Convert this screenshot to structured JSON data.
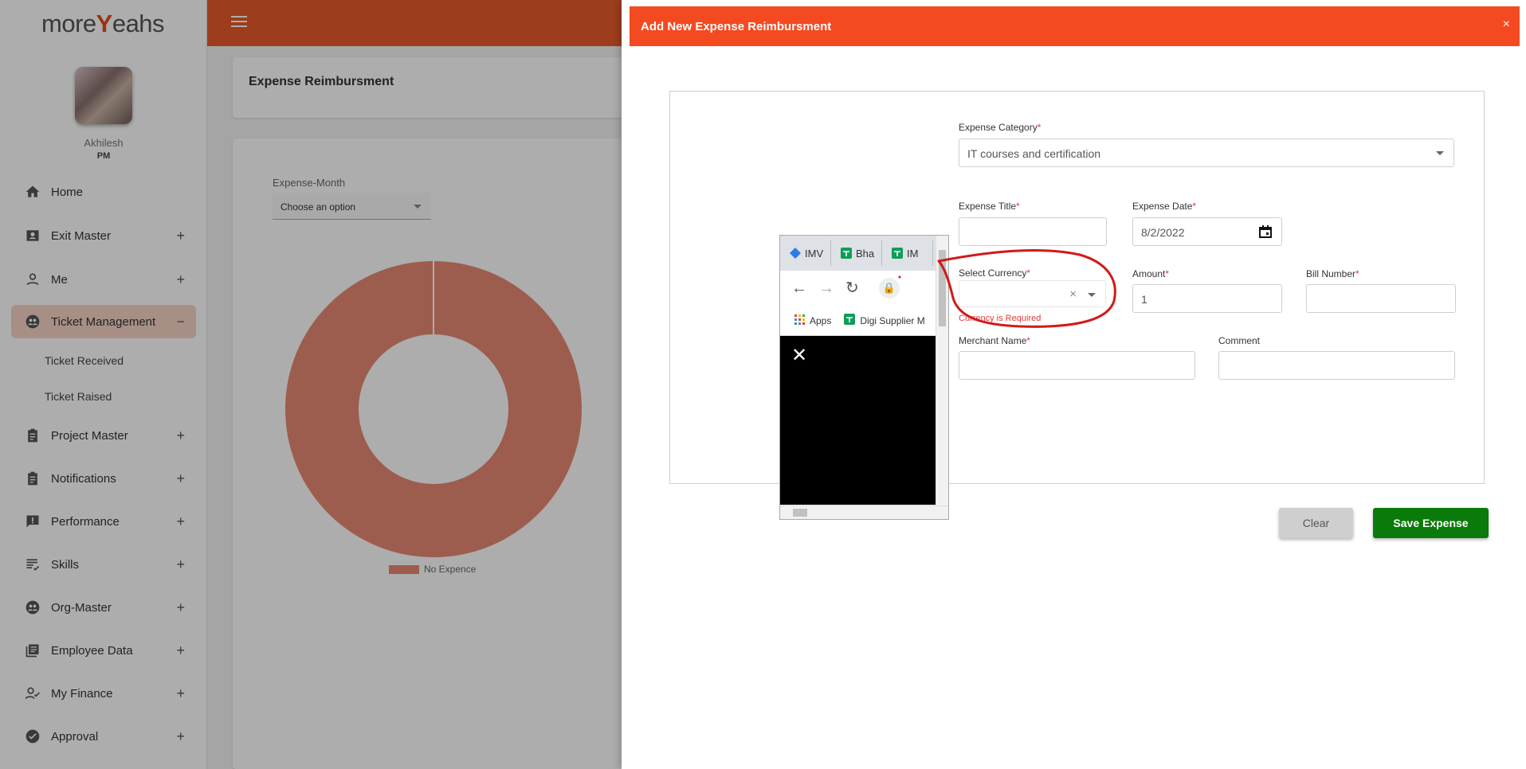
{
  "app": {
    "logo_text_a": "more",
    "logo_text_b": "Y",
    "logo_text_c": "eahs"
  },
  "user": {
    "name": "Akhilesh",
    "role": "PM"
  },
  "sidebar": {
    "items": [
      {
        "label": "Home",
        "icon": "home-icon",
        "plus": ""
      },
      {
        "label": "Exit Master",
        "icon": "badge-icon",
        "plus": "+"
      },
      {
        "label": "Me",
        "icon": "person-icon",
        "plus": "+"
      },
      {
        "label": "Ticket Management",
        "icon": "people-group-icon",
        "plus": "−"
      },
      {
        "label": "Project Master",
        "icon": "clipboard-icon",
        "plus": "+"
      },
      {
        "label": "Notifications",
        "icon": "clipboard-icon",
        "plus": "+"
      },
      {
        "label": "Performance",
        "icon": "feedback-icon",
        "plus": "+"
      },
      {
        "label": "Skills",
        "icon": "list-icon",
        "plus": "+"
      },
      {
        "label": "Org-Master",
        "icon": "people-group-icon",
        "plus": "+"
      },
      {
        "label": "Employee Data",
        "icon": "library-icon",
        "plus": "+"
      },
      {
        "label": "My Finance",
        "icon": "person-check-icon",
        "plus": "+"
      },
      {
        "label": "Approval",
        "icon": "check-circle-icon",
        "plus": "+"
      }
    ],
    "subitems": [
      "Ticket Received",
      "Ticket Raised"
    ]
  },
  "main": {
    "title": "Expense Reimbursment",
    "month_label": "Expense-Month",
    "month_placeholder": "Choose an option",
    "legend_label": "No Expence"
  },
  "chart_data": {
    "type": "pie",
    "categories": [
      "No Expence"
    ],
    "values": [
      1
    ],
    "colors": [
      "#e88a73"
    ],
    "donut": true
  },
  "dialog": {
    "title": "Add New Expense Reimbursment",
    "close": "×",
    "attachment": {
      "tabs": [
        "IMV",
        "Bha",
        "IM"
      ],
      "bookmarks": [
        "Apps",
        "Digi Supplier M"
      ]
    },
    "fields": {
      "category": {
        "label": "Expense Category",
        "value": "IT courses and certification"
      },
      "title": {
        "label": "Expense Title",
        "value": ""
      },
      "date": {
        "label": "Expense Date",
        "value": "8/2/2022"
      },
      "currency": {
        "label": "Select Currency",
        "value": "",
        "error": "Currency is Required",
        "clear": "×"
      },
      "amount": {
        "label": "Amount",
        "value": "1"
      },
      "bill": {
        "label": "Bill Number",
        "value": ""
      },
      "merchant": {
        "label": "Merchant Name",
        "value": ""
      },
      "comment": {
        "label": "Comment",
        "value": ""
      }
    },
    "required_mark": "*",
    "clear_label": "Clear",
    "save_label": "Save Expense"
  },
  "colors": {
    "accent": "#f44a21",
    "header": "#e65a2b",
    "save": "#0a7a0a",
    "error": "#e53935",
    "annotation": "#d11a1a"
  }
}
